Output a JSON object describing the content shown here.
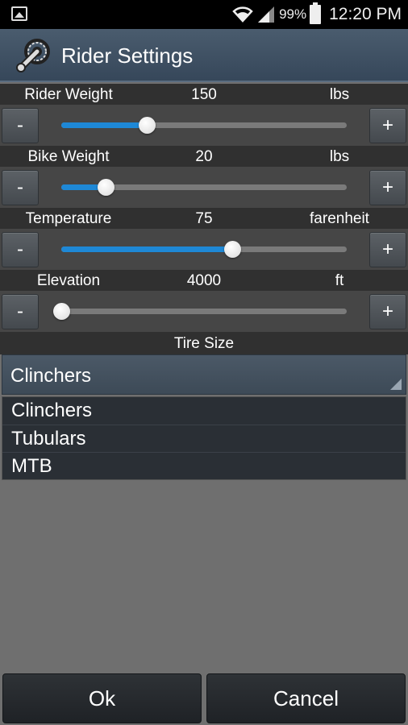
{
  "status_bar": {
    "battery_percent": "99%",
    "time": "12:20 PM"
  },
  "header": {
    "title": "Rider Settings",
    "icon": "bike-crank-icon"
  },
  "settings": [
    {
      "label": "Rider Weight",
      "value": "150",
      "unit": "lbs",
      "minus": "-",
      "plus": "+",
      "level": 0.3
    },
    {
      "label": "Bike Weight",
      "value": "20",
      "unit": "lbs",
      "minus": "-",
      "plus": "+",
      "level": 0.155
    },
    {
      "label": "Temperature",
      "value": "75",
      "unit": "farenheit",
      "minus": "-",
      "plus": "+",
      "level": 0.6
    },
    {
      "label": "Elevation",
      "value": "4000",
      "unit": "ft",
      "minus": "-",
      "plus": "+",
      "level": 0.0
    }
  ],
  "tire": {
    "label": "Tire Size",
    "selected": "Clinchers",
    "options": [
      "Clinchers",
      "Tubulars",
      "MTB"
    ]
  },
  "actions": {
    "ok": "Ok",
    "cancel": "Cancel"
  },
  "colors": {
    "accent": "#1e88d6",
    "header": "#3e4f61"
  }
}
